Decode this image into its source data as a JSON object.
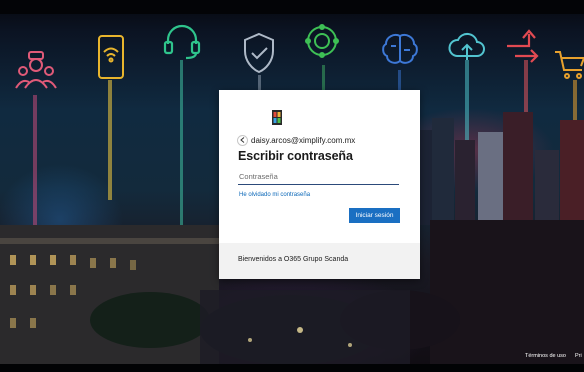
{
  "card": {
    "account_email": "daisy.arcos@ximplify.com.mx",
    "title": "Escribir contraseña",
    "password_placeholder": "Contraseña",
    "forgot_link": "He olvidado mi contraseña",
    "signin_button": "Iniciar sesión",
    "welcome_message": "Bienvenidos a O365 Grupo Scanda",
    "logo_icon": "company-logo-icon",
    "back_icon": "back-arrow-icon"
  },
  "footer": {
    "terms_link": "Términos de uso",
    "privacy_link": "Pri"
  },
  "background": {
    "icons": [
      "people-icon",
      "smartphone-wifi-icon",
      "headset-icon",
      "shield-check-icon",
      "gear-network-icon",
      "brain-icon",
      "cloud-upload-icon",
      "arrows-icon",
      "cart-icon"
    ]
  },
  "colors": {
    "accent": "#1a6fc2",
    "link": "#0a67b8"
  }
}
